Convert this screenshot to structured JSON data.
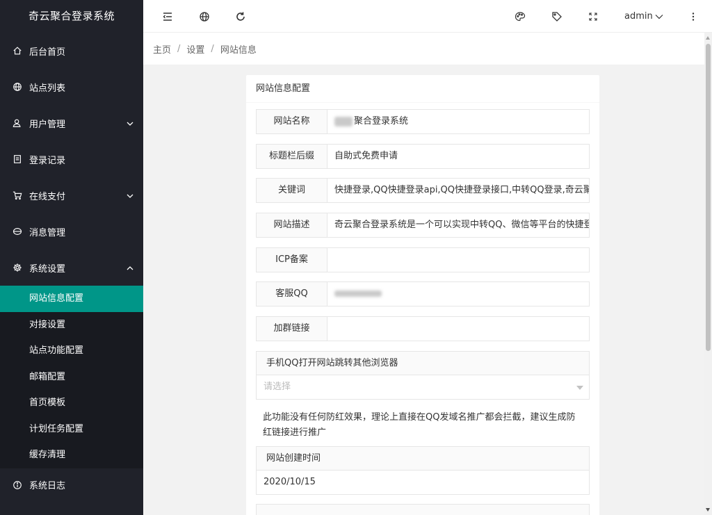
{
  "app": {
    "title": "奇云聚合登录系统"
  },
  "sidebar": {
    "items": [
      {
        "label": "后台首页",
        "icon": "home-icon"
      },
      {
        "label": "站点列表",
        "icon": "globe-icon"
      },
      {
        "label": "用户管理",
        "icon": "user-icon"
      },
      {
        "label": "登录记录",
        "icon": "document-icon"
      },
      {
        "label": "在线支付",
        "icon": "cart-icon"
      },
      {
        "label": "消息管理",
        "icon": "message-icon"
      },
      {
        "label": "系统设置",
        "icon": "gear-icon"
      }
    ],
    "subitems": [
      {
        "label": "网站信息配置"
      },
      {
        "label": "对接设置"
      },
      {
        "label": "站点功能配置"
      },
      {
        "label": "邮箱配置"
      },
      {
        "label": "首页模板"
      },
      {
        "label": "计划任务配置"
      },
      {
        "label": "缓存清理"
      }
    ],
    "bottom": {
      "label": "系统日志",
      "icon": "info-icon"
    }
  },
  "header": {
    "user": "admin"
  },
  "breadcrumb": [
    "主页",
    "设置",
    "网站信息"
  ],
  "card": {
    "title": "网站信息配置",
    "fields": [
      {
        "label": "网站名称",
        "value": "聚合登录系统"
      },
      {
        "label": "标题栏后缀",
        "value": "自助式免费申请"
      },
      {
        "label": "关键词",
        "value": "快捷登录,QQ快捷登录api,QQ快捷登录接口,中转QQ登录,奇云聚合登录"
      },
      {
        "label": "网站描述",
        "value": "奇云聚合登录系统是一个可以实现中转QQ、微信等平台的快捷登录系统"
      },
      {
        "label": "ICP备案",
        "value": ""
      },
      {
        "label": "客服QQ",
        "value": ""
      },
      {
        "label": "加群链接",
        "value": ""
      }
    ],
    "select": {
      "title": "手机QQ打开网站跳转其他浏览器",
      "placeholder": "请选择"
    },
    "tip": "此功能没有任何防红效果，理论上直接在QQ发域名推广都会拦截，建议生成防红链接进行推广",
    "created": {
      "title": "网站创建时间",
      "value": "2020/10/15"
    }
  },
  "colors": {
    "sidebar_bg": "#20222a",
    "sidebar_sub_bg": "#181a20",
    "accent": "#009688"
  }
}
